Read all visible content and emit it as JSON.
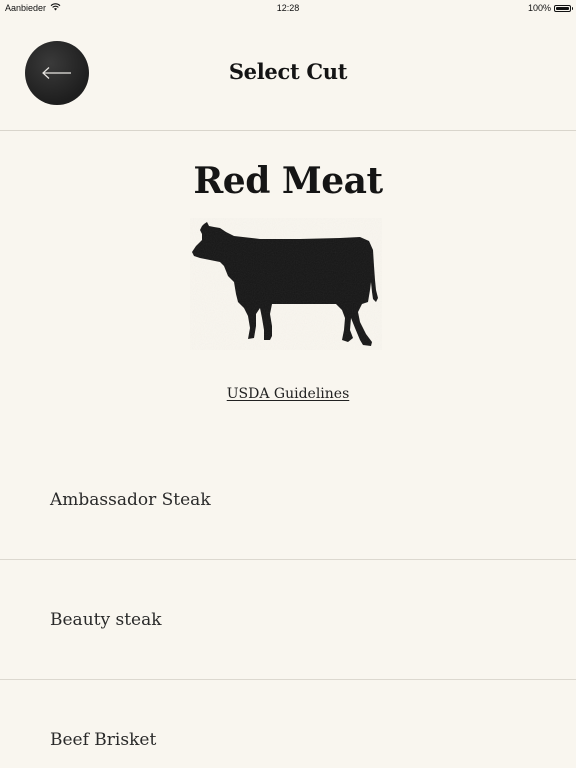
{
  "status_bar": {
    "carrier": "Aanbieder",
    "time": "12:28",
    "battery_percent": "100%",
    "battery_level": 1.0,
    "wifi_icon": "wifi-icon"
  },
  "header": {
    "title": "Select Cut",
    "back_icon": "arrow-left-icon"
  },
  "category": {
    "title": "Red Meat",
    "illustration": "cow-silhouette",
    "guidelines_link": "USDA Guidelines"
  },
  "cuts": [
    {
      "label": "Ambassador Steak"
    },
    {
      "label": "Beauty steak"
    },
    {
      "label": "Beef Brisket"
    }
  ],
  "colors": {
    "background": "#f9f6ef",
    "text": "#1c1c1c",
    "button": "#2a2a2a",
    "divider": "#dcd8cf"
  }
}
